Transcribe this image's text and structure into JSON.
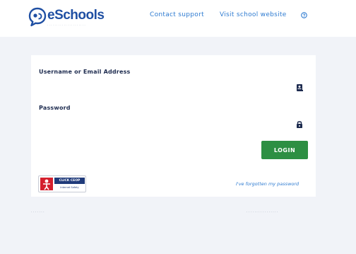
{
  "colors": {
    "brand": "#1f4fa3",
    "link": "#2e7bd1",
    "login_button": "#2d8f43",
    "background": "#f1f3f8"
  },
  "header": {
    "logo_text": "eSchools",
    "logo_icon": "chat-bubble-logo-icon",
    "nav": {
      "contact_support": "Contact support",
      "visit_website": "Visit school website",
      "help_icon": "question-circle-icon"
    }
  },
  "login_form": {
    "username_label": "Username or Email Address",
    "username_value": "",
    "username_icon": "user-card-icon",
    "password_label": "Password",
    "password_value": "",
    "password_icon": "lock-icon",
    "login_button_label": "LOGIN",
    "forgot_password_link": "I've forgotten my password"
  },
  "badge": {
    "icon": "click-ceop-icon",
    "top_text": "CLICK CEOP",
    "bottom_text": "Internet Safety"
  }
}
